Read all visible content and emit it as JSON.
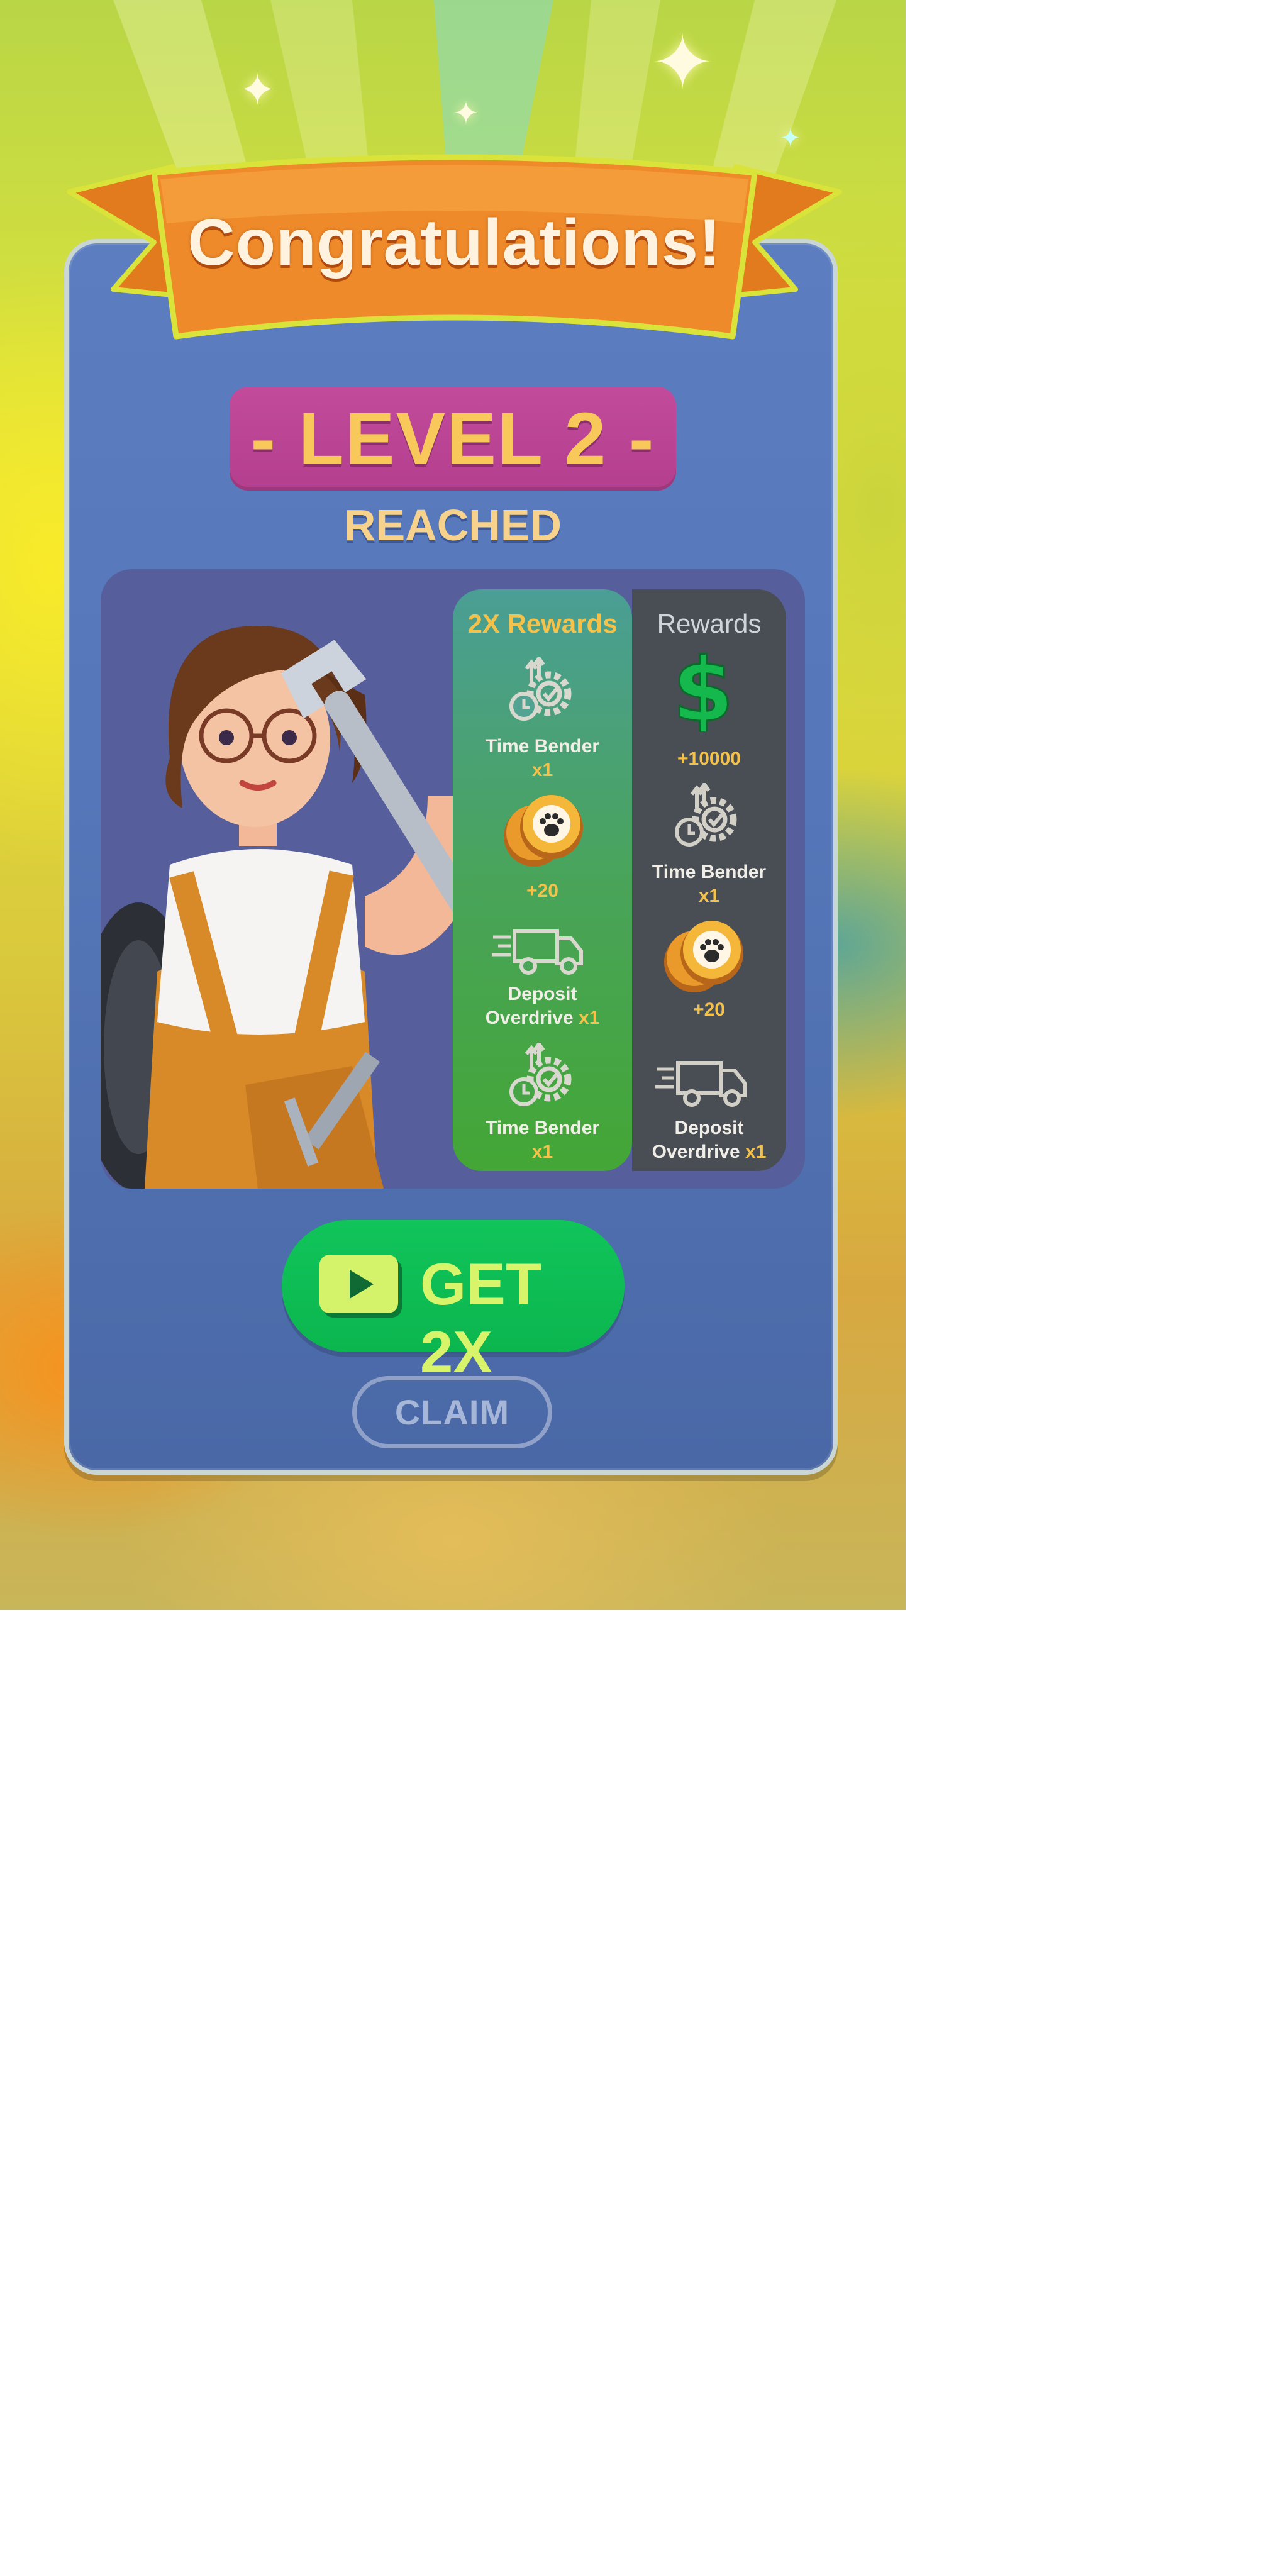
{
  "title": "Congratulations!",
  "level": {
    "text": "- LEVEL 2 -",
    "status": "REACHED"
  },
  "rewards_2x": {
    "header": "2X Rewards",
    "items": [
      {
        "icon": "time-bender-icon",
        "name": "Time Bender",
        "qty": "x1"
      },
      {
        "icon": "paw-coin-icon",
        "value": "+20"
      },
      {
        "icon": "delivery-truck-icon",
        "name_line1": "Deposit",
        "name_line2": "Overdrive",
        "qty": "x1"
      },
      {
        "icon": "time-bender-icon",
        "name": "Time Bender",
        "qty": "x1"
      }
    ]
  },
  "rewards": {
    "header": "Rewards",
    "items": [
      {
        "icon": "dollar-sign-icon",
        "value": "+10000"
      },
      {
        "icon": "time-bender-icon",
        "name": "Time Bender",
        "qty": "x1"
      },
      {
        "icon": "paw-coin-icon",
        "value": "+20"
      },
      {
        "icon": "delivery-truck-icon",
        "name_line1": "Deposit",
        "name_line2": "Overdrive",
        "qty": "x1"
      }
    ]
  },
  "buttons": {
    "get2x": "GET 2X",
    "claim": "CLAIM"
  },
  "colors": {
    "panel": "#5577b9",
    "ribbon": "#ee8424",
    "level_badge": "#b43f8e",
    "level_text": "#f8c95a",
    "get2x_button": "#0cb64f",
    "accent_text": "#f4c24a"
  }
}
